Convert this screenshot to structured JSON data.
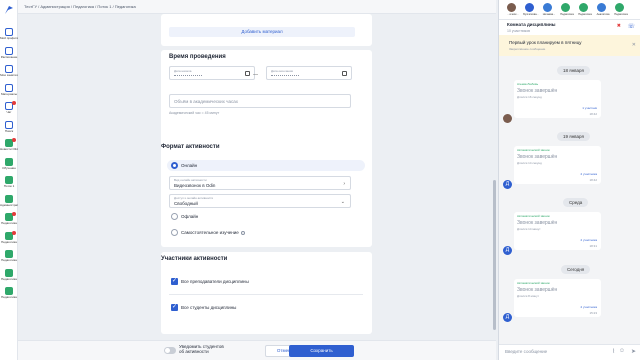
{
  "breadcrumb": [
    "ТестГУ",
    "Администрация",
    "Педагогика",
    "Поток 1",
    "Педагогика"
  ],
  "sidebar": [
    {
      "label": "Мой профиль",
      "badge": false
    },
    {
      "label": "Расписание",
      "badge": false
    },
    {
      "label": "Мои занятия",
      "badge": false
    },
    {
      "label": "Материалы",
      "badge": false
    },
    {
      "label": "Чат",
      "badge": true
    },
    {
      "label": "Поиск",
      "badge": false
    },
    {
      "label": "Новости Olivity",
      "badge": true
    },
    {
      "label": "Обучение",
      "badge": false
    },
    {
      "label": "Поток 1",
      "badge": false
    },
    {
      "label": "Администратор",
      "badge": false
    },
    {
      "label": "Педагогика",
      "badge": true
    },
    {
      "label": "Педагогика",
      "badge": true
    },
    {
      "label": "Педагогика",
      "badge": false
    },
    {
      "label": "Педагогика",
      "badge": false
    },
    {
      "label": "Педагогика",
      "badge": false
    }
  ],
  "form": {
    "add_material": "Добавить материал",
    "time_title": "Время проведения",
    "date_start": "Дата начала",
    "date_end": "Дата окончания",
    "dash": "—",
    "hours_placeholder": "Объём в академических часах",
    "hours_hint": "Академический час = 45 минут",
    "format_title": "Формат активности",
    "online": "Онлайн",
    "tool_caption": "Вид онлайн активности",
    "tool_value": "Видеозвонок в Odin",
    "access_caption": "Доступ к онлайн активности",
    "access_value": "Свободный",
    "offline": "Офлайн",
    "self_study": "Самостоятельное изучение",
    "participants_title": "Участники активности",
    "all_teachers": "Все преподаватели дисциплины",
    "all_students": "Все студенты дисциплины"
  },
  "footer": {
    "notify": "Уведомить студентов об активности",
    "cancel": "Отмена",
    "save": "Сохранить"
  },
  "chat": {
    "avatars": [
      {
        "name": "...ическ...",
        "color": "#7a5c4e"
      },
      {
        "name": "Булгаткова...",
        "color": "#2f5fd0"
      },
      {
        "name": "Нечаева...",
        "color": "#3a7bd5"
      },
      {
        "name": "Педагогика",
        "color": "#2fa86a"
      },
      {
        "name": "Педагогика",
        "color": "#2fa86a"
      },
      {
        "name": "Аналитика",
        "color": "#3a7bd5"
      },
      {
        "name": "Педагогика",
        "color": "#2fa86a"
      }
    ],
    "title": "Комната дисциплины",
    "subtitle": "10 участников",
    "pinned": "Первый урок планируем в пятницу",
    "pinned_sub": "Закреплённое сообщение",
    "dates": [
      "18 января",
      "19 января",
      "Среда",
      "Сегодня"
    ],
    "messages": [
      {
        "author": "Агеева Любовь",
        "text": "Звонок завершён",
        "duration": "Длился 16 секунд",
        "participants": "1 участник",
        "time": "18:42"
      },
      {
        "author": "Автоматический звонок",
        "text": "Звонок завершён",
        "duration": "Длился 14 секунд",
        "participants": "2 участника",
        "time": "18:42"
      },
      {
        "author": "Автоматический звонок",
        "text": "Звонок завершён",
        "duration": "Длился 14 минут",
        "participants": "2 участника",
        "time": "18:31"
      },
      {
        "author": "Автоматический звонок",
        "text": "Звонок завершён",
        "duration": "Длился 8 минут",
        "participants": "2 участника",
        "time": "15:23"
      }
    ],
    "input_placeholder": "Введите сообщение"
  },
  "colors": {
    "accent": "#2f5fd0",
    "pinned_bg": "#fdf5dc",
    "page_bg": "#eceff3"
  }
}
